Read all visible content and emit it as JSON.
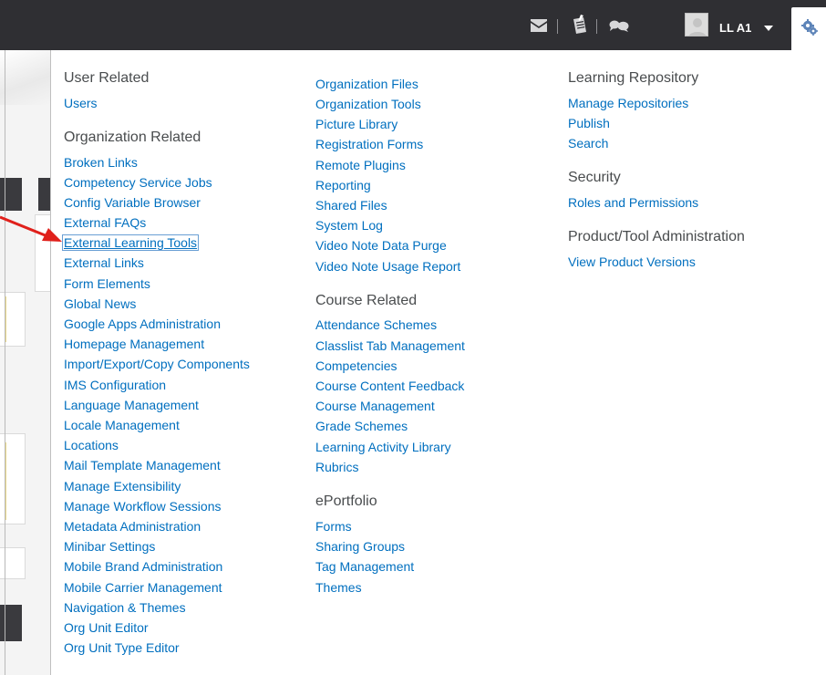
{
  "navbar": {
    "icons": [
      "mail-icon",
      "notepad-icon",
      "chat-bubbles-icon"
    ],
    "user_name": "LL A1",
    "settings_icon": "gear-icon"
  },
  "menu": {
    "columns": [
      {
        "groups": [
          {
            "title": "User Related",
            "links": [
              "Users"
            ]
          },
          {
            "title": "Organization Related",
            "links": [
              "Broken Links",
              "Competency Service Jobs",
              "Config Variable Browser",
              "External FAQs",
              "External Learning Tools",
              "External Links",
              "Form Elements",
              "Global News",
              "Google Apps Administration",
              "Homepage Management",
              "Import/Export/Copy Components",
              "IMS Configuration",
              "Language Management",
              "Locale Management",
              "Locations",
              "Mail Template Management",
              "Manage Extensibility",
              "Manage Workflow Sessions",
              "Metadata Administration",
              "Minibar Settings",
              "Mobile Brand Administration",
              "Mobile Carrier Management",
              "Navigation & Themes",
              "Org Unit Editor",
              "Org Unit Type Editor"
            ]
          }
        ]
      },
      {
        "groups": [
          {
            "title": "",
            "links": [
              "Organization Files",
              "Organization Tools",
              "Picture Library",
              "Registration Forms",
              "Remote Plugins",
              "Reporting",
              "Shared Files",
              "System Log",
              "Video Note Data Purge",
              "Video Note Usage Report"
            ]
          },
          {
            "title": "Course Related",
            "links": [
              "Attendance Schemes",
              "Classlist Tab Management",
              "Competencies",
              "Course Content Feedback",
              "Course Management",
              "Grade Schemes",
              "Learning Activity Library",
              "Rubrics"
            ]
          },
          {
            "title": "ePortfolio",
            "links": [
              "Forms",
              "Sharing Groups",
              "Tag Management",
              "Themes"
            ]
          }
        ]
      },
      {
        "groups": [
          {
            "title": "Learning Repository",
            "links": [
              "Manage Repositories",
              "Publish",
              "Search"
            ]
          },
          {
            "title": "Security",
            "links": [
              "Roles and Permissions"
            ]
          },
          {
            "title": "Product/Tool Administration",
            "links": [
              "View Product Versions"
            ]
          }
        ]
      }
    ],
    "focused_link": "External Learning Tools"
  },
  "colors": {
    "navbar_bg": "#2f2f33",
    "link": "#006fbf",
    "heading": "#494c4e",
    "annotation_arrow": "#e0201b"
  }
}
